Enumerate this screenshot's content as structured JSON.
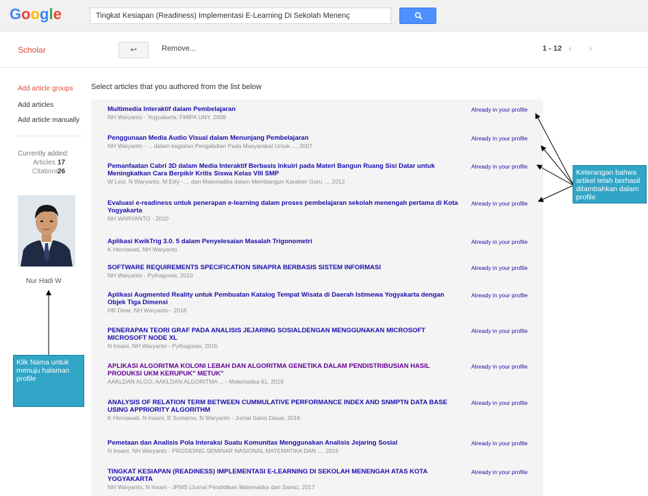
{
  "header": {
    "logo": [
      "G",
      "o",
      "o",
      "g",
      "l",
      "e"
    ],
    "logo_colors": [
      "#4285f4",
      "#ea4335",
      "#fbbc05",
      "#4285f4",
      "#34a853",
      "#ea4335"
    ],
    "search_value": "Tingkat Kesiapan (Readiness) Implementasi E-Learning Di Sekolah Menenç",
    "search_icon": "search-icon"
  },
  "subbar": {
    "scholar_label": "Scholar",
    "back_icon": "↩",
    "remove_label": "Remove...",
    "pager": "1 - 12",
    "prev_icon": "‹",
    "next_icon": "›"
  },
  "sidebar": {
    "items": [
      {
        "label": "Add article groups",
        "active": true
      },
      {
        "label": "Add articles",
        "active": false
      },
      {
        "label": "Add article manually",
        "active": false
      }
    ],
    "currently_added_label": "Currently added:",
    "articles_label": "Articles",
    "articles_value": "17",
    "citations_label": "Citations",
    "citations_value": "26",
    "author_name": "Nur Hadi W"
  },
  "main": {
    "section_title": "Select articles that you authored from the list below",
    "articles": [
      {
        "title": "Multimedia Interaktif dalam Pembelajaran",
        "meta": "NH Waryanto - Yogyakarta: FMIPA UNY, 2008",
        "status": "Already in your profile",
        "visited": false
      },
      {
        "title": "Penggunaan Media Audio Visual dalam Menunjang Pembelajaran",
        "meta": "NH Waryanto - ... dalam kegiatan Pengabdian Pada Masyarakat Untuk ..., 2007",
        "status": "Already in your profile",
        "visited": false
      },
      {
        "title": "Pemanfaatan Cabri 3D dalam Media Interaktif Berbasis Inkuiri pada Materi Bangun Ruang Sisi Datar untuk Meningkatkan Cara Berpikir Kritis Siswa Kelas VIII SMP",
        "meta": "W Lesi, N Waryanto, M Eiliy - ... dan Matematika dalam Membangun Karakter Guru ..., 2012",
        "status": "Already in your profile",
        "visited": false
      },
      {
        "title": "Evaluasi e-readiness untuk penerapan e-learning dalam proses pembelajaran sekolah menengah pertama di Kota Yogyakarta",
        "meta": "NH WARYANTO - 2010",
        "status": "Already in your profile",
        "visited": false
      },
      {
        "title": "Aplikasi KwikTrig 3.0. 5 dalam Penyelesaian Masalah Trigonometri",
        "meta": "K Hernawati, NH Waryanto",
        "status": "Already in your profile",
        "visited": false
      },
      {
        "title": "SOFTWARE REQUIREMENTS SPECIFICATION SINAPRA BERBASIS SISTEM INFORMASI",
        "meta": "NH Waryanto - Pythagoras, 2010",
        "status": "Already in your profile",
        "visited": false
      },
      {
        "title": "Aplikasi Augmented Reality untuk Pembuatan Katalog Tempat Wisata di Daerah Istimewa Yogyakarta dengan Objek Tiga Dimensi",
        "meta": "HR Dewi, NH Waryanto - 2016",
        "status": "Already in your profile",
        "visited": false
      },
      {
        "title": "PENERAPAN TEORI GRAF PADA ANALISIS JEJARING SOSIALDENGAN MENGGUNAKAN MICROSOFT MICROSOFT NODE XL",
        "meta": "N Insani, NH Waryanto - Pythagoras, 2015",
        "status": "Already in your profile",
        "visited": false
      },
      {
        "title": "APLIKASI ALGORITMA KOLONI LEBAH DAN ALGORITMA GENETIKA DALAM PENDISTRIBUSIAN HASIL PRODUKSI UKM KERUPUK\" METUK\"",
        "meta": "AAKLDAN ALGO, AAKLDAN ALGORITMA ... - Matematika 61, 2016",
        "status": "Already in your profile",
        "visited": true
      },
      {
        "title": "ANALYSIS OF RELATION TERM BETWEEN CUMMULATIVE PERFORMANCE INDEX AND SNMPTN DATA BASE USING APPRIORITY ALGORITHM",
        "meta": "K Hernawati, N Insani, B Sumarno, N Waryanto - Jurnal Sains Dasar, 2016",
        "status": "Already in your profile",
        "visited": false
      },
      {
        "title": "Pemetaan dan Analisis Pola Interaksi Suatu Komunitas Menggunakan Analisis Jejaring Sosial",
        "meta": "N Insani, NH Waryanto - PROSIDING SEMINAR NASIONAL MATEMATIKA DAN ..., 2015",
        "status": "Already in your profile",
        "visited": false
      },
      {
        "title": "TINGKAT KESIAPAN (READINESS) IMPLEMENTASI E-LEARNING DI SEKOLAH MENENGAH ATAS KOTA YOGYAKARTA",
        "meta": "NH Waryanto, N Insani - JPMS (Jurnal Pendidikan Matematika dan Sains), 2017",
        "status": "Already in your profile",
        "visited": false
      }
    ]
  },
  "annotations": {
    "right_callout": "Keterangan bahwa artikel telah berhasil ditambahkan dalam profile",
    "left_callout": "Klik Nama untuk menuju halaman profile"
  }
}
